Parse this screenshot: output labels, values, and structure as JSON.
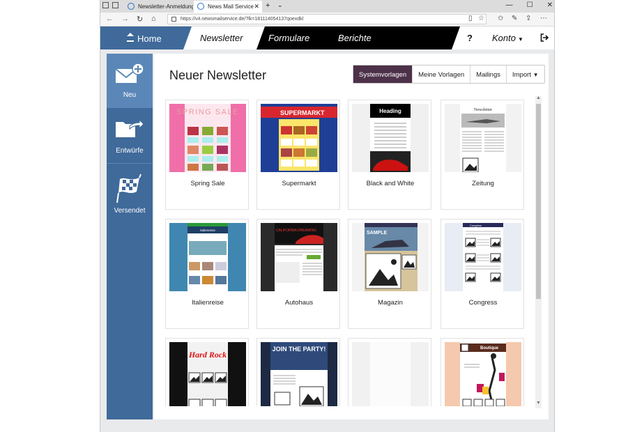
{
  "browser": {
    "tabs": [
      {
        "label": "Newsletter-Anmeldung, Na"
      },
      {
        "label": "News Mail Service"
      }
    ],
    "url": "https://v4.newsmailservice.de/?lk=181114054137qoexdkl"
  },
  "appnav": {
    "home": "Home",
    "newsletter": "Newsletter",
    "formulare": "Formulare",
    "berichte": "Berichte",
    "help": "?",
    "konto": "Konto"
  },
  "sidebar": {
    "items": [
      {
        "label": "Neu"
      },
      {
        "label": "Entwürfe"
      },
      {
        "label": "Versendet"
      }
    ]
  },
  "main": {
    "title": "Neuer Newsletter",
    "segments": [
      {
        "label": "Systemvorlagen"
      },
      {
        "label": "Meine Vorlagen"
      },
      {
        "label": "Mailings"
      },
      {
        "label": "Import"
      }
    ],
    "templates": [
      {
        "label": "Spring Sale",
        "thumb_text": "SPRING SALE"
      },
      {
        "label": "Supermarkt",
        "thumb_text": "SUPERMARKT"
      },
      {
        "label": "Black and White",
        "thumb_text": "Heading"
      },
      {
        "label": "Zeitung",
        "thumb_text": "Newsletter"
      },
      {
        "label": "Italienreise",
        "thumb_text": "Italienreise"
      },
      {
        "label": "Autohaus",
        "thumb_text": "CALIFORNIA DREAMING"
      },
      {
        "label": "Magazin",
        "thumb_text": "SAMPLE"
      },
      {
        "label": "Congress",
        "thumb_text": "Congress"
      },
      {
        "label": "",
        "thumb_text": "Hard Rock"
      },
      {
        "label": "",
        "thumb_text": "JOIN THE PARTY!"
      },
      {
        "label": "",
        "thumb_text": ""
      },
      {
        "label": "",
        "thumb_text": "Boutique"
      }
    ]
  },
  "colors": {
    "primary_blue": "#3f6a9a",
    "sidebar_active": "#5b87b8",
    "segment_active": "#4d3149"
  }
}
